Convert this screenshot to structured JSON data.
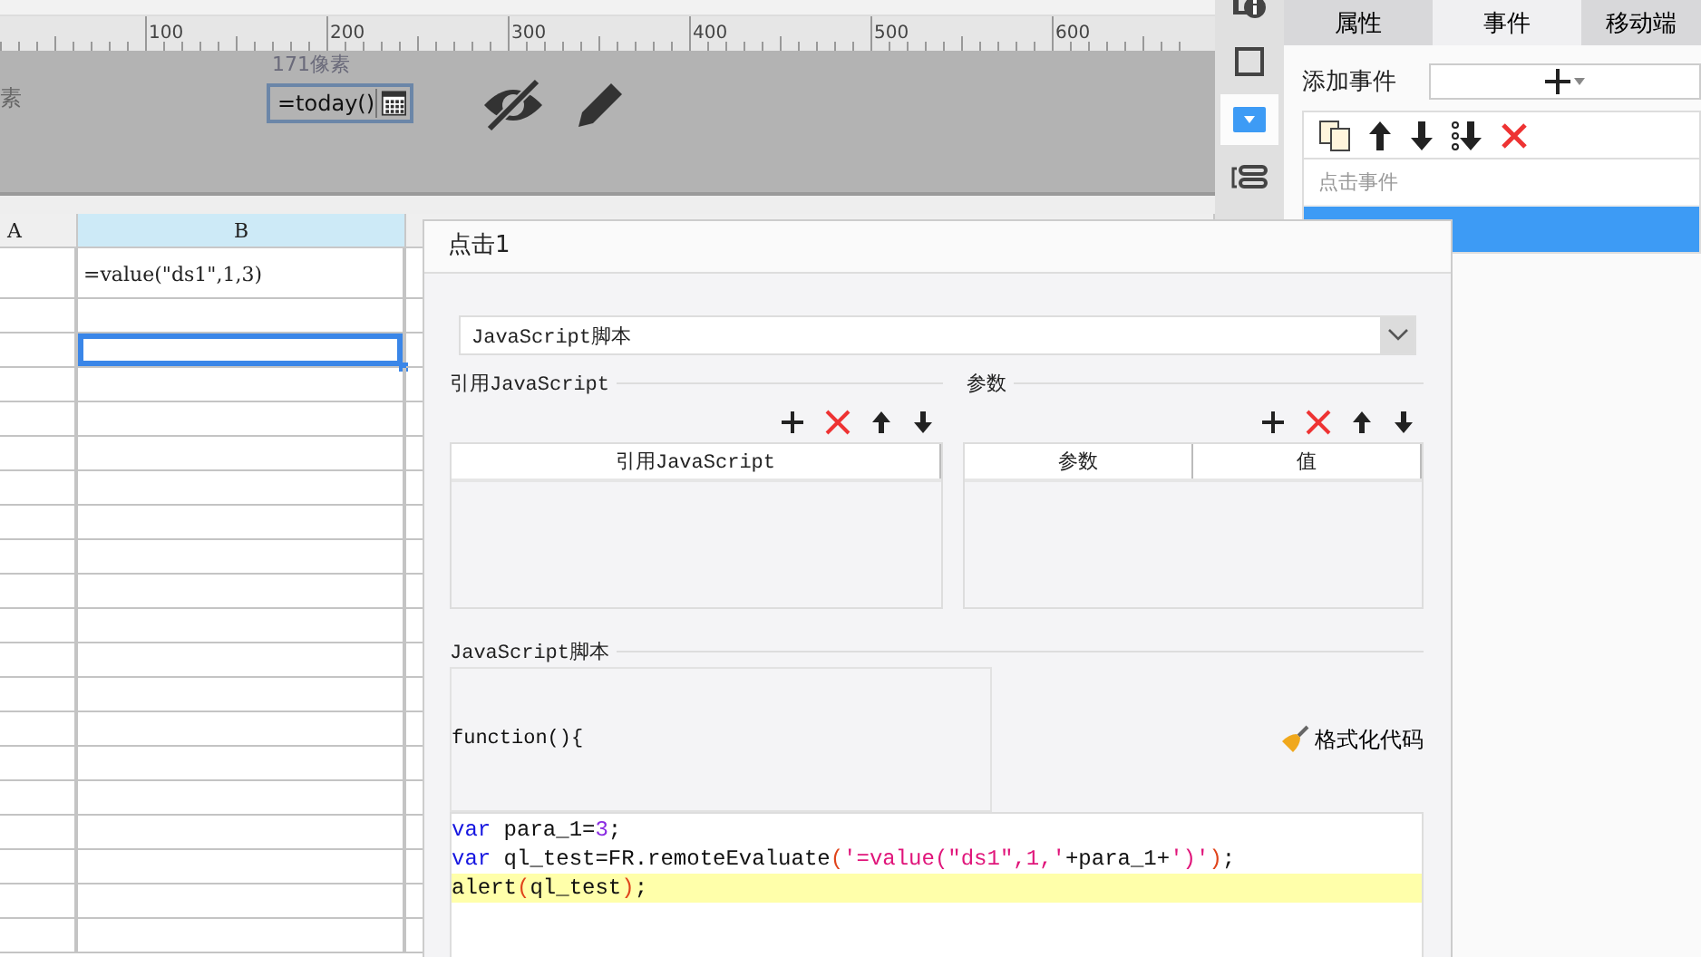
{
  "ruler": {
    "labels": [
      "100",
      "200",
      "300",
      "400",
      "500",
      "600"
    ]
  },
  "canvas": {
    "left_label": "素",
    "size_label": "171像素",
    "date_field": {
      "value": "=today()"
    }
  },
  "sheet": {
    "columns": [
      {
        "label": "A",
        "selected": false
      },
      {
        "label": "B",
        "selected": true
      }
    ],
    "rows": [
      {
        "column_b": "=value(\"ds1\",1,3)",
        "selected": false
      },
      {
        "selected": false
      },
      {
        "selected": true
      },
      {
        "selected": false
      },
      {
        "selected": false
      },
      {
        "selected": false
      },
      {
        "selected": false
      },
      {
        "selected": false
      },
      {
        "selected": false
      },
      {
        "selected": false
      },
      {
        "selected": false
      },
      {
        "selected": false
      },
      {
        "selected": false
      },
      {
        "selected": false
      },
      {
        "selected": false
      },
      {
        "selected": false
      },
      {
        "selected": false
      },
      {
        "selected": false
      },
      {
        "selected": false
      },
      {
        "selected": false
      }
    ]
  },
  "side_tools": [
    {
      "kind": "info",
      "selected": false
    },
    {
      "kind": "frame",
      "selected": false
    },
    {
      "kind": "dropdown",
      "selected": true
    },
    {
      "kind": "list",
      "selected": false
    }
  ],
  "panel": {
    "tabs": [
      {
        "label": "属性",
        "selected": false
      },
      {
        "label": "事件",
        "selected": true
      },
      {
        "label": "移动端",
        "selected": false
      }
    ],
    "add_event": {
      "label": "添加事件"
    },
    "event_list": {
      "header": "点击事件",
      "items": [
        {
          "selected": true
        }
      ]
    }
  },
  "dialog": {
    "title": "点击1",
    "type_select": {
      "value": "JavaScript脚本"
    },
    "imports": {
      "title": "引用JavaScript",
      "columns": [
        "引用JavaScript"
      ]
    },
    "params": {
      "title": "参数",
      "columns": [
        "参数",
        "值"
      ]
    },
    "script": {
      "title": "JavaScript脚本",
      "signature": "function(){",
      "format_button": "格式化代码",
      "lines": [
        {
          "highlighted": false,
          "tokens": [
            {
              "kind": "keyword",
              "text": "var"
            },
            {
              "kind": "plain",
              "text": " para_1="
            },
            {
              "kind": "number",
              "text": "3"
            },
            {
              "kind": "plain",
              "text": ";"
            }
          ]
        },
        {
          "highlighted": false,
          "tokens": [
            {
              "kind": "keyword",
              "text": "var"
            },
            {
              "kind": "plain",
              "text": " ql_test=FR.remoteEvaluate"
            },
            {
              "kind": "paren",
              "text": "("
            },
            {
              "kind": "string",
              "text": "'=value(\"ds1\",1,'"
            },
            {
              "kind": "plain",
              "text": "+para_1+"
            },
            {
              "kind": "string",
              "text": "')'"
            },
            {
              "kind": "paren",
              "text": ")"
            },
            {
              "kind": "plain",
              "text": ";"
            }
          ]
        },
        {
          "highlighted": true,
          "tokens": [
            {
              "kind": "plain",
              "text": "alert"
            },
            {
              "kind": "paren",
              "text": "("
            },
            {
              "kind": "plain",
              "text": "ql_test"
            },
            {
              "kind": "paren",
              "text": ")"
            },
            {
              "kind": "plain",
              "text": ";"
            }
          ]
        }
      ]
    }
  }
}
